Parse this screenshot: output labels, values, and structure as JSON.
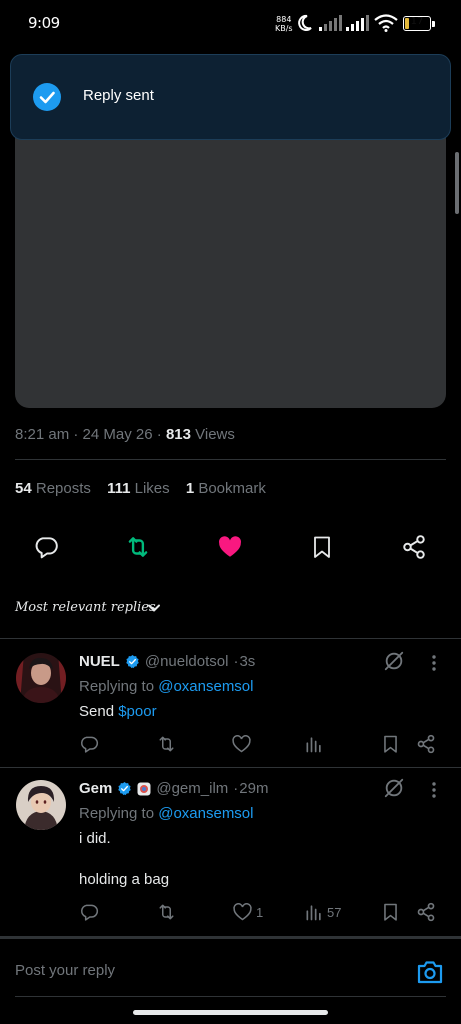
{
  "status_bar": {
    "time": "9:09",
    "net_speed_value": "884",
    "net_speed_unit": "KB/s",
    "battery": "17",
    "battery_level": 0.17
  },
  "toast": {
    "message": "Reply sent"
  },
  "post": {
    "time": "8:21 am",
    "date": "24 May 26",
    "views_count": "813",
    "views_label": "Views",
    "reposts_count": "54",
    "reposts_label": "Reposts",
    "likes_count": "111",
    "likes_label": "Likes",
    "bookmarks_count": "1",
    "bookmarks_label": "Bookmark",
    "liked": true,
    "reposted": true
  },
  "replies_sort": {
    "label": "Most relevant replies"
  },
  "replies": [
    {
      "name": "NUEL",
      "handle": "@nueldotsol",
      "time": "3s",
      "replying_prefix": "Replying to",
      "replying_to": "@oxansemsol",
      "text_prefix": "Send",
      "text_cashtag": "$poor",
      "likes": "",
      "views": ""
    },
    {
      "name": "Gem",
      "handle": "@gem_ilm",
      "time": "29m",
      "replying_prefix": "Replying to",
      "replying_to": "@oxansemsol",
      "line1": "i did.",
      "line2": "holding a bag",
      "likes": "1",
      "views": "57"
    }
  ],
  "composer": {
    "placeholder": "Post your reply"
  },
  "colors": {
    "accent": "#1d9bf0",
    "like": "#f91880",
    "repost": "#00ba7c",
    "muted": "#71767b"
  }
}
